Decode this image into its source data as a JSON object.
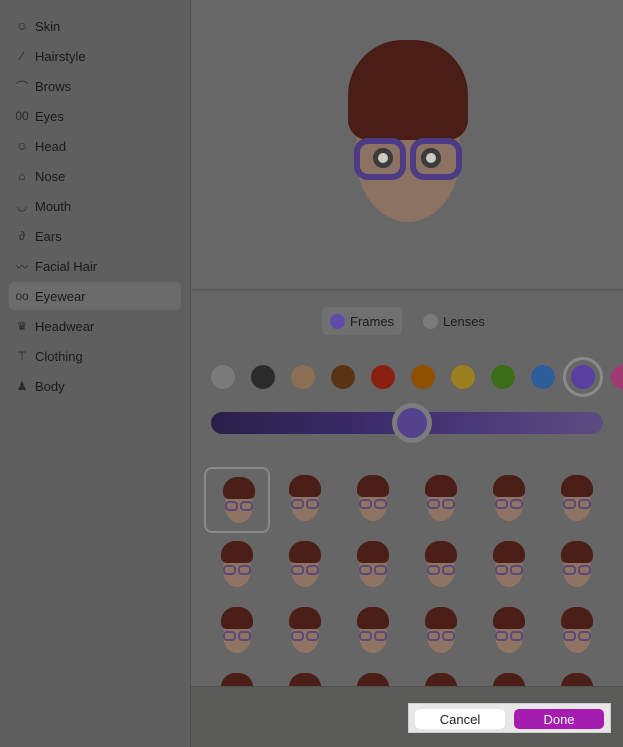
{
  "sidebar": {
    "items": [
      {
        "label": "Skin",
        "icon": "face-circle-icon",
        "glyph": "☺"
      },
      {
        "label": "Hairstyle",
        "icon": "comb-icon",
        "glyph": "⁄"
      },
      {
        "label": "Brows",
        "icon": "brow-icon",
        "glyph": "⌒"
      },
      {
        "label": "Eyes",
        "icon": "eyes-icon",
        "glyph": "00"
      },
      {
        "label": "Head",
        "icon": "head-icon",
        "glyph": "☺"
      },
      {
        "label": "Nose",
        "icon": "nose-icon",
        "glyph": "⌂"
      },
      {
        "label": "Mouth",
        "icon": "mouth-icon",
        "glyph": "◡"
      },
      {
        "label": "Ears",
        "icon": "ear-icon",
        "glyph": "∂"
      },
      {
        "label": "Facial Hair",
        "icon": "mustache-icon",
        "glyph": "〰"
      },
      {
        "label": "Eyewear",
        "icon": "glasses-icon",
        "glyph": "oo",
        "selected": true
      },
      {
        "label": "Headwear",
        "icon": "crown-icon",
        "glyph": "♛"
      },
      {
        "label": "Clothing",
        "icon": "shirt-icon",
        "glyph": "⊤"
      },
      {
        "label": "Body",
        "icon": "person-icon",
        "glyph": "♟"
      }
    ]
  },
  "editor": {
    "tabs": [
      {
        "label": "Frames",
        "color": "#5f4aa8",
        "selected": true
      },
      {
        "label": "Lenses",
        "color": "#7c7c7c"
      }
    ],
    "swatches": [
      "#7a7a7a",
      "#2b2b2b",
      "#8a6f55",
      "#5a3313",
      "#8a2012",
      "#8f5000",
      "#9a7e20",
      "#3c6e1a",
      "#2e5d9c",
      "#5a3fa0",
      "#a03a70"
    ],
    "selected_swatch": 9,
    "shade_slider": 0.5,
    "frame_options": 24,
    "selected_frame": 0
  },
  "footer": {
    "cancel": "Cancel",
    "done": "Done"
  }
}
